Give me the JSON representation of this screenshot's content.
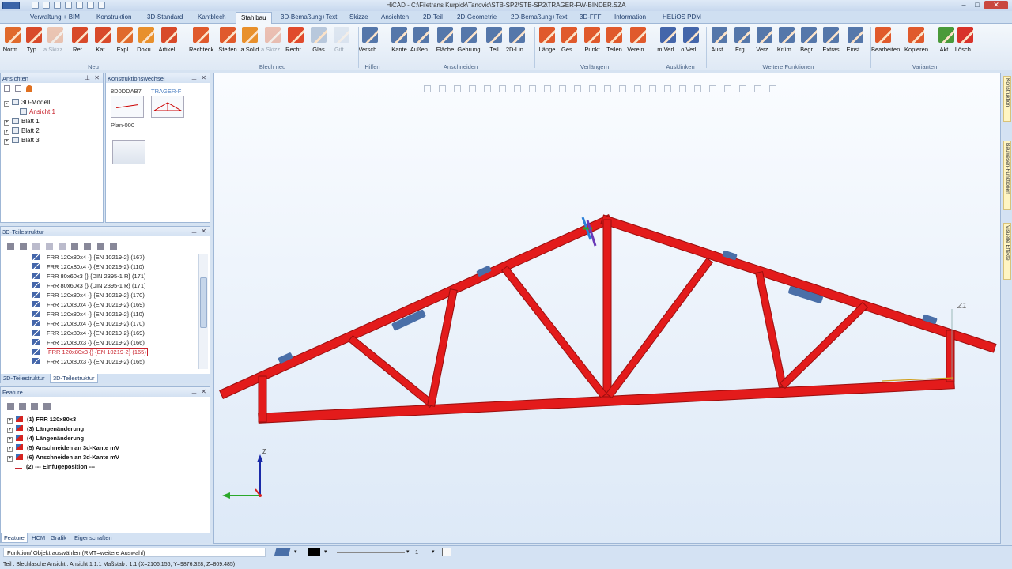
{
  "window": {
    "title": "HiCAD - C:\\Filetrans Kurpick\\Tanovic\\STB-SP2\\STB-SP2\\TRÄGER-FW-BINDER.SZA"
  },
  "tabs": [
    "Verwaltung + BIM",
    "Konstruktion",
    "3D-Standard",
    "Kantblech",
    "Stahlbau",
    "3D-Bemaßung+Text",
    "Skizze",
    "Ansichten",
    "2D-Teil",
    "2D-Geometrie",
    "2D-Bemaßung+Text",
    "3D-FFF",
    "Information",
    "HELiOS PDM"
  ],
  "active_tab": "Stahlbau",
  "ribbon": {
    "buttons": [
      {
        "label": "Norm...",
        "color": "#e06a2c",
        "dim": false
      },
      {
        "label": "Typ...",
        "color": "#d84a2a",
        "dim": false
      },
      {
        "label": "a.Skizz...",
        "color": "#e06a2c",
        "dim": true
      },
      {
        "label": "Ref...",
        "color": "#d84a2a",
        "dim": false
      },
      {
        "label": "Kat...",
        "color": "#d84a2a",
        "dim": false
      },
      {
        "label": "Expl...",
        "color": "#e06a2c",
        "dim": false
      },
      {
        "label": "Doku...",
        "color": "#e8902c",
        "dim": false
      },
      {
        "label": "Artikel...",
        "color": "#d84a2a",
        "dim": false
      },
      {
        "label": "Rechteck",
        "color": "#e05a2c",
        "dim": false
      },
      {
        "label": "Steifen",
        "color": "#e05a2c",
        "dim": false
      },
      {
        "label": "a.Solid",
        "color": "#e8902c",
        "dim": false
      },
      {
        "label": "a.Skizz...",
        "color": "#e05a2c",
        "dim": true
      },
      {
        "label": "Recht...",
        "color": "#e04a2c",
        "dim": false
      },
      {
        "label": "Glas",
        "color": "#b8c8dc",
        "dim": false
      },
      {
        "label": "Gitt...",
        "color": "#b8c8dc",
        "dim": true
      },
      {
        "label": "Versch...",
        "color": "#5577aa",
        "dim": false
      },
      {
        "label": "Kante",
        "color": "#5577aa",
        "dim": false
      },
      {
        "label": "Außen...",
        "color": "#5577aa",
        "dim": false
      },
      {
        "label": "Fläche",
        "color": "#5577aa",
        "dim": false
      },
      {
        "label": "Gehrung",
        "color": "#5577aa",
        "dim": false
      },
      {
        "label": "Teil",
        "color": "#5577aa",
        "dim": false
      },
      {
        "label": "2D-Lin...",
        "color": "#5577aa",
        "dim": false
      },
      {
        "label": "Länge",
        "color": "#e05a2c",
        "dim": false
      },
      {
        "label": "Ges...",
        "color": "#e05a2c",
        "dim": false
      },
      {
        "label": "Punkt",
        "color": "#e05a2c",
        "dim": false
      },
      {
        "label": "Teilen",
        "color": "#e05a2c",
        "dim": false
      },
      {
        "label": "Verein...",
        "color": "#e05a2c",
        "dim": false
      },
      {
        "label": "m.Verl...",
        "color": "#4466aa",
        "dim": false
      },
      {
        "label": "o.Verl...",
        "color": "#4466aa",
        "dim": false
      },
      {
        "label": "Aust...",
        "color": "#5577aa",
        "dim": false
      },
      {
        "label": "Erg...",
        "color": "#5577aa",
        "dim": false
      },
      {
        "label": "Verz...",
        "color": "#5577aa",
        "dim": false
      },
      {
        "label": "Krüm...",
        "color": "#5577aa",
        "dim": false
      },
      {
        "label": "Begr...",
        "color": "#5577aa",
        "dim": false
      },
      {
        "label": "Extras",
        "color": "#5577aa",
        "dim": false
      },
      {
        "label": "Einst...",
        "color": "#5577aa",
        "dim": false
      },
      {
        "label": "Bearbeiten",
        "color": "#e05a2c",
        "dim": false
      },
      {
        "label": "Kopieren",
        "color": "#e05a2c",
        "dim": false
      },
      {
        "label": "Akt...",
        "color": "#4a9a3a",
        "dim": false
      },
      {
        "label": "Lösch...",
        "color": "#d8332a",
        "dim": false
      }
    ],
    "groups": [
      "Neu",
      "Blech neu",
      "Hilfen",
      "Anschneiden",
      "Verlängern",
      "Ausklinken",
      "Weitere Funktionen",
      "Varianten"
    ]
  },
  "ansichten": {
    "title": "Ansichten",
    "items": [
      {
        "label": "3D-Modell",
        "level": 0,
        "exp": "-",
        "active": false
      },
      {
        "label": "Ansicht 1",
        "level": 1,
        "exp": "",
        "active": true
      },
      {
        "label": "Blatt 1",
        "level": 0,
        "exp": "+",
        "active": false
      },
      {
        "label": "Blatt 2",
        "level": 0,
        "exp": "+",
        "active": false
      },
      {
        "label": "Blatt 3",
        "level": 0,
        "exp": "+",
        "active": false
      }
    ]
  },
  "konstruktionswechsel": {
    "title": "Konstruktionswechsel",
    "thumb1_label": "8D0DDAB7",
    "thumb2_label": "TRÄGER-F",
    "plan_label": "Plan-000"
  },
  "teilestruktur": {
    "title": "3D-Teilestruktur",
    "items": [
      "FRR 120x80x4 {} {EN 10219-2} (167)",
      "FRR 120x80x4 {} {EN 10219-2} (110)",
      "FRR 80x60x3 {} {DIN 2395-1 R} (171)",
      "FRR 80x60x3 {} {DIN 2395-1 R} (171)",
      "FRR 120x80x4 {} {EN 10219-2} (170)",
      "FRR 120x80x4 {} {EN 10219-2} (169)",
      "FRR 120x80x4 {} {EN 10219-2} (110)",
      "FRR 120x80x4 {} {EN 10219-2} (170)",
      "FRR 120x80x4 {} {EN 10219-2} (169)",
      "FRR 120x80x3 {} {EN 10219-2} (166)",
      "FRR 120x80x3 {} {EN 10219-2} (165)",
      "FRR 120x80x3 {} {EN 10219-2} (165)"
    ],
    "selected_index": 11,
    "tabs": [
      "2D-Teilestruktur",
      "3D-Teilestruktur"
    ]
  },
  "feature": {
    "title": "Feature",
    "items": [
      "(1) FRR 120x80x3",
      "(3) Längenänderung",
      "(4) Längenänderung",
      "(5) Anschneiden an 3d-Kante mV",
      "(6) Anschneiden an 3d-Kante mV",
      "(2) --- Einfügeposition ---"
    ],
    "bottom_tabs": [
      "Feature",
      "HCM",
      "Grafik",
      "Eigenschaften"
    ]
  },
  "right_tabs": [
    "Konstruktion",
    "Bauwesen-Funktionen",
    "Visuelle Effekte"
  ],
  "viewport": {
    "label_z1": "Z1",
    "axis_z": "Z"
  },
  "statusbar": {
    "prompt": "Funktion/ Objekt auswählen (RMT=weitere Auswahl)",
    "line_value": "1",
    "status": "Teil : Blechlasche   Ansicht : Ansicht 1 1:1   Maßstab : 1:1   (X=2106.156, Y=9876.328, Z=809.485)"
  },
  "colors": {
    "truss": "#e31b1b",
    "truss_edge": "#9a0e0e",
    "plate": "#4a6fa8"
  }
}
